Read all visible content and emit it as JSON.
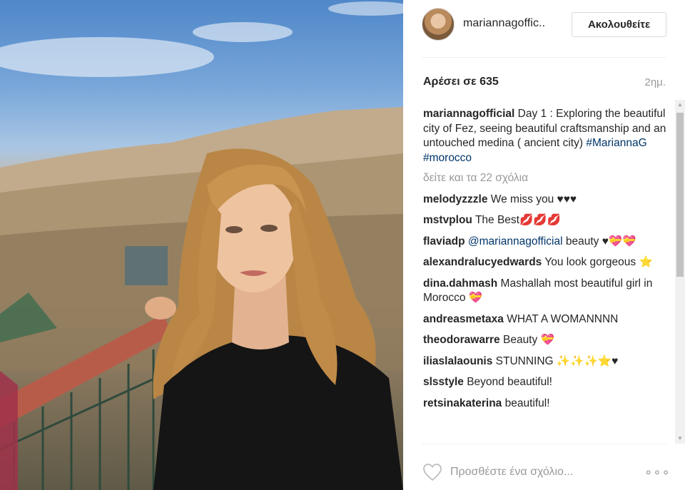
{
  "header": {
    "username": "mariannagoffic..",
    "follow_label": "Ακολουθείτε"
  },
  "stats": {
    "likes": "Αρέσει σε 635",
    "time": "2ημ."
  },
  "caption": {
    "user": "mariannagofficial",
    "text": "Day 1 : Exploring the beautiful city of Fez, seeing beautiful craftsmanship and an untouched medina ( ancient city)",
    "tag1": "#MariannaG",
    "tag2": "#morocco"
  },
  "view_all": "δείτε και τα 22 σχόλια",
  "comments": [
    {
      "user": "melodyzzzle",
      "text": "We miss you ♥♥♥"
    },
    {
      "user": "mstvplou",
      "text": "The Best💋💋💋"
    },
    {
      "user": "flaviadp",
      "mention": "@mariannagofficial",
      "text": "beauty ♥💝💝"
    },
    {
      "user": "alexandralucyedwards",
      "text": "You look gorgeous ⭐"
    },
    {
      "user": "dina.dahmash",
      "text": "Mashallah most beautiful girl in Morocco 💝"
    },
    {
      "user": "andreasmetaxa",
      "text": "WHAT A WOMANNNN"
    },
    {
      "user": "theodorawarre",
      "text": "Beauty 💝"
    },
    {
      "user": "iliaslalaounis",
      "text": "STUNNING ✨✨✨⭐♥"
    },
    {
      "user": "slsstyle",
      "text": "Beyond beautiful!"
    },
    {
      "user": "retsinakaterina",
      "text": "beautiful!"
    }
  ],
  "footer": {
    "comment_placeholder": "Προσθέστε ένα σχόλιο...",
    "more_label": "∘∘∘"
  },
  "icons": {
    "like": "heart-icon",
    "more": "more-options-icon"
  }
}
